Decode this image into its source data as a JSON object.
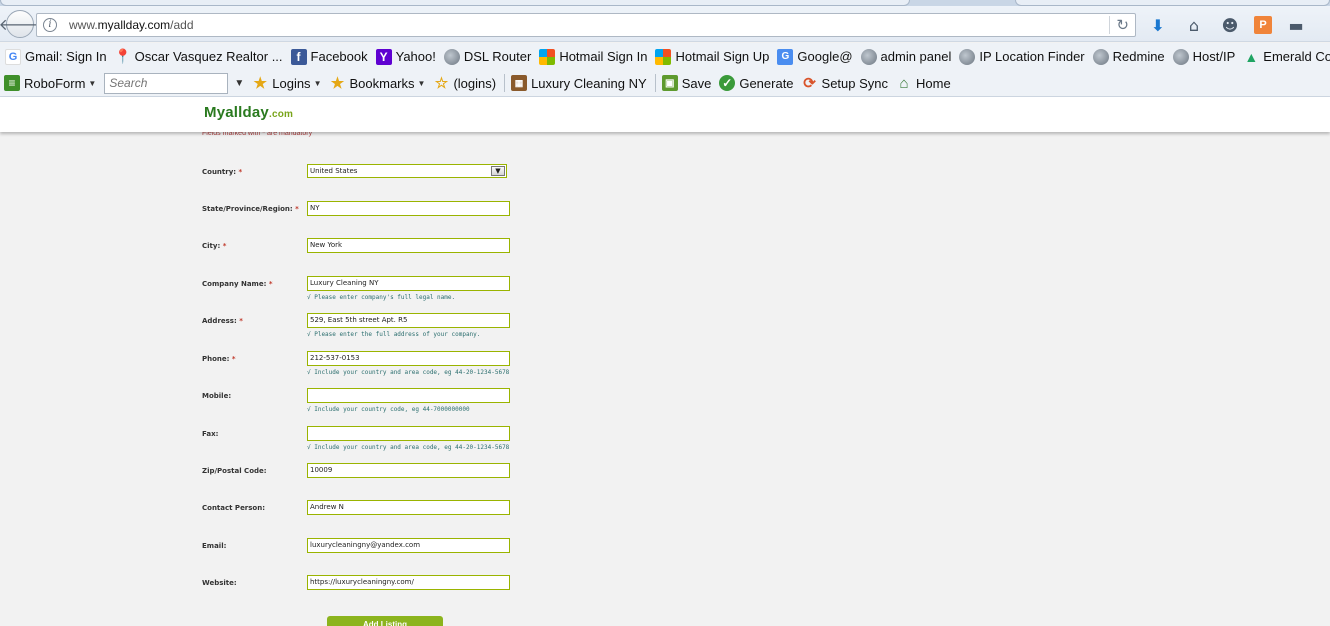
{
  "browser": {
    "url_prefix": "www.",
    "url_domain": "myallday.com",
    "url_path": "/add",
    "back_glyph": "🡐",
    "reload_glyph": "↻"
  },
  "bookmarks_bar": [
    {
      "label": "Gmail: Sign In",
      "icon": "google-icon",
      "glyph": "G",
      "cls": "g"
    },
    {
      "label": "Oscar Vasquez Realtor ...",
      "icon": "map-pin-icon",
      "glyph": "📍",
      "cls": "pin"
    },
    {
      "label": "Facebook",
      "icon": "facebook-icon",
      "glyph": "f",
      "cls": "fb"
    },
    {
      "label": "Yahoo!",
      "icon": "yahoo-icon",
      "glyph": "Y",
      "cls": "yh"
    },
    {
      "label": "DSL Router",
      "icon": "globe-icon",
      "glyph": "",
      "cls": "globe"
    },
    {
      "label": "Hotmail Sign In",
      "icon": "microsoft-icon",
      "glyph": "",
      "cls": "ms"
    },
    {
      "label": "Hotmail Sign Up",
      "icon": "microsoft-icon",
      "glyph": "",
      "cls": "ms"
    },
    {
      "label": "Google@",
      "icon": "google-translate-icon",
      "glyph": "G",
      "cls": "gt"
    },
    {
      "label": "admin panel",
      "icon": "globe-icon",
      "glyph": "",
      "cls": "globe"
    },
    {
      "label": "IP Location Finder",
      "icon": "globe-icon",
      "glyph": "",
      "cls": "globe"
    },
    {
      "label": "Redmine",
      "icon": "globe-icon",
      "glyph": "",
      "cls": "globe"
    },
    {
      "label": "Host/IP",
      "icon": "globe-icon",
      "glyph": "",
      "cls": "globe"
    },
    {
      "label": "Emerald Connect Mast...",
      "icon": "google-drive-icon",
      "glyph": "▲",
      "cls": "drive"
    }
  ],
  "roboform_bar": {
    "roboform_label": "RoboForm",
    "search_placeholder": "Search",
    "logins_label": "Logins",
    "bookmarks_label": "Bookmarks",
    "logins2_label": "(logins)",
    "luxury_label": "Luxury Cleaning NY",
    "save_label": "Save",
    "generate_label": "Generate",
    "setup_sync_label": "Setup Sync",
    "home_label": "Home"
  },
  "site": {
    "logo_text": "Myallday",
    "logo_domain": ".com",
    "mandatory_note": "Fields marked with * are mandatory"
  },
  "form": {
    "country": {
      "label": "Country:",
      "value": "United States"
    },
    "state": {
      "label": "State/Province/Region:",
      "value": "NY"
    },
    "city": {
      "label": "City:",
      "value": "New York"
    },
    "company": {
      "label": "Company Name:",
      "value": "Luxury Cleaning NY",
      "hint": "√ Please enter company's full legal name."
    },
    "address": {
      "label": "Address:",
      "value": "529, East 5th street Apt. R5",
      "hint": "√ Please enter the full address of your company."
    },
    "phone": {
      "label": "Phone:",
      "value": "212-537-0153",
      "hint": "√ Include your country and area code, eg 44-20-1234-5678"
    },
    "mobile": {
      "label": "Mobile:",
      "value": "",
      "hint": "√ Include your country code, eg 44-7000000000"
    },
    "fax": {
      "label": "Fax:",
      "value": "",
      "hint": "√ Include your country and area code, eg 44-20-1234-5678"
    },
    "zip": {
      "label": "Zip/Postal Code:",
      "value": "10009"
    },
    "contact": {
      "label": "Contact Person:",
      "value": "Andrew N"
    },
    "email": {
      "label": "Email:",
      "value": "luxurycleaningny@yandex.com"
    },
    "website": {
      "label": "Website:",
      "value": "https://luxurycleaningny.com/"
    },
    "required_mark": "*",
    "submit_label": "Add Listing"
  }
}
